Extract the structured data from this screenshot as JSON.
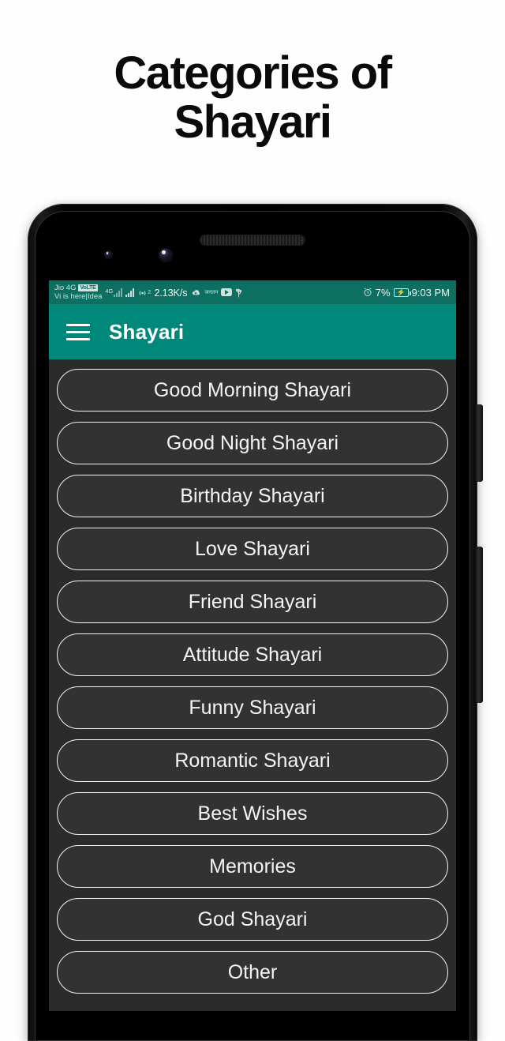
{
  "promo": {
    "line1": "Categories of",
    "line2": "Shayari"
  },
  "phone": {
    "statusbar": {
      "carrier_line1": "Jio 4G",
      "volte_badge": "VoLTE",
      "carrier_line2": "Vi is here|Idea",
      "network_gen": "4G",
      "data_speed": "2.13K/s",
      "hindi_badge": "जनतन",
      "hotspot_superscript": "2",
      "battery_percent": "7%",
      "clock": "9:03 PM",
      "icons": {
        "download": "☁",
        "usb": "ψ",
        "alarm": "⏱"
      }
    },
    "appbar": {
      "menu_icon": "hamburger-icon",
      "title": "Shayari",
      "color": "#00897b"
    },
    "categories": [
      {
        "label": "Good Morning Shayari"
      },
      {
        "label": "Good Night Shayari"
      },
      {
        "label": "Birthday Shayari"
      },
      {
        "label": "Love Shayari"
      },
      {
        "label": "Friend Shayari"
      },
      {
        "label": "Attitude Shayari"
      },
      {
        "label": "Funny Shayari"
      },
      {
        "label": "Romantic Shayari"
      },
      {
        "label": "Best Wishes"
      },
      {
        "label": "Memories"
      },
      {
        "label": "God Shayari"
      },
      {
        "label": "Other"
      }
    ]
  },
  "colors": {
    "accent_teal": "#00897b",
    "statusbar_teal": "#0d6f62",
    "screen_bg": "#2b2b2b",
    "pill_bg": "#323232",
    "pill_border": "#f2f2f2",
    "page_bg": "#fefefe",
    "headline": "#0a0a0a"
  }
}
